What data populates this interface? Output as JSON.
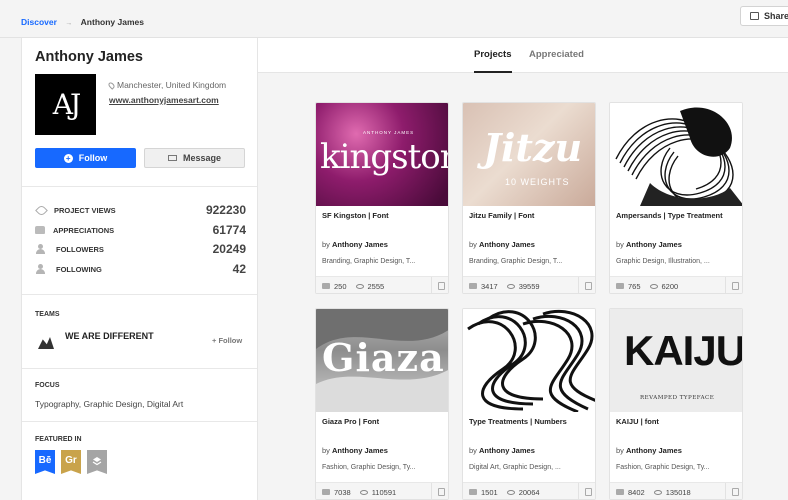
{
  "breadcrumb": {
    "parent": "Discover",
    "current": "Anthony James"
  },
  "header": {
    "share_label": "Share"
  },
  "profile": {
    "name": "Anthony James",
    "avatar_text": "AJ",
    "location": "Manchester, United Kingdom",
    "website": "www.anthonyjamesart.com",
    "follow_label": "Follow",
    "message_label": "Message"
  },
  "stats": [
    {
      "label": "PROJECT VIEWS",
      "value": "922230",
      "icon": "eye-icon"
    },
    {
      "label": "APPRECIATIONS",
      "value": "61774",
      "icon": "thumbs-up-icon"
    },
    {
      "label": "FOLLOWERS",
      "value": "20249",
      "icon": "user-icon"
    },
    {
      "label": "FOLLOWING",
      "value": "42",
      "icon": "user-plus-icon"
    }
  ],
  "teams": {
    "title": "TEAMS",
    "name": "WE ARE DIFFERENT",
    "follow_label": "+ Follow"
  },
  "focus": {
    "title": "FOCUS",
    "text": "Typography, Graphic Design, Digital Art"
  },
  "featured": {
    "title": "FEATURED IN",
    "badges": [
      {
        "label": "Bē",
        "color": "#1769ff"
      },
      {
        "label": "Gr",
        "color": "#c9a34b"
      },
      {
        "label": "",
        "color": "#a5a5a5"
      }
    ]
  },
  "tabs": [
    {
      "label": "Projects",
      "active": true
    },
    {
      "label": "Appreciated",
      "active": false
    }
  ],
  "projects": [
    {
      "title": "SF Kingston | Font",
      "by_prefix": "by",
      "author": "Anthony James",
      "fields": "Branding, Graphic Design, T...",
      "likes": "250",
      "views": "2555",
      "cover_text": "kingston",
      "cover_sub": "ANTHONY JAMES"
    },
    {
      "title": "Jitzu Family | Font",
      "by_prefix": "by",
      "author": "Anthony James",
      "fields": "Branding, Graphic Design, T...",
      "likes": "3417",
      "views": "39559",
      "cover_text": "Jitzu",
      "cover_sub": "10 WEIGHTS"
    },
    {
      "title": "Ampersands | Type Treatment",
      "by_prefix": "by",
      "author": "Anthony James",
      "fields": "Graphic Design, Illustration, ...",
      "likes": "765",
      "views": "6200"
    },
    {
      "title": "Giaza Pro | Font",
      "by_prefix": "by",
      "author": "Anthony James",
      "fields": "Fashion, Graphic Design, Ty...",
      "likes": "7038",
      "views": "110591",
      "cover_text": "Giaza"
    },
    {
      "title": "Type Treatments | Numbers",
      "by_prefix": "by",
      "author": "Anthony James",
      "fields": "Digital Art, Graphic Design, ...",
      "likes": "1501",
      "views": "20064"
    },
    {
      "title": "KAIJU | font",
      "by_prefix": "by",
      "author": "Anthony James",
      "fields": "Fashion, Graphic Design, Ty...",
      "likes": "8402",
      "views": "135018",
      "cover_text": "KAIJU",
      "cover_sub": "REVAMPED TYPEFACE"
    }
  ]
}
